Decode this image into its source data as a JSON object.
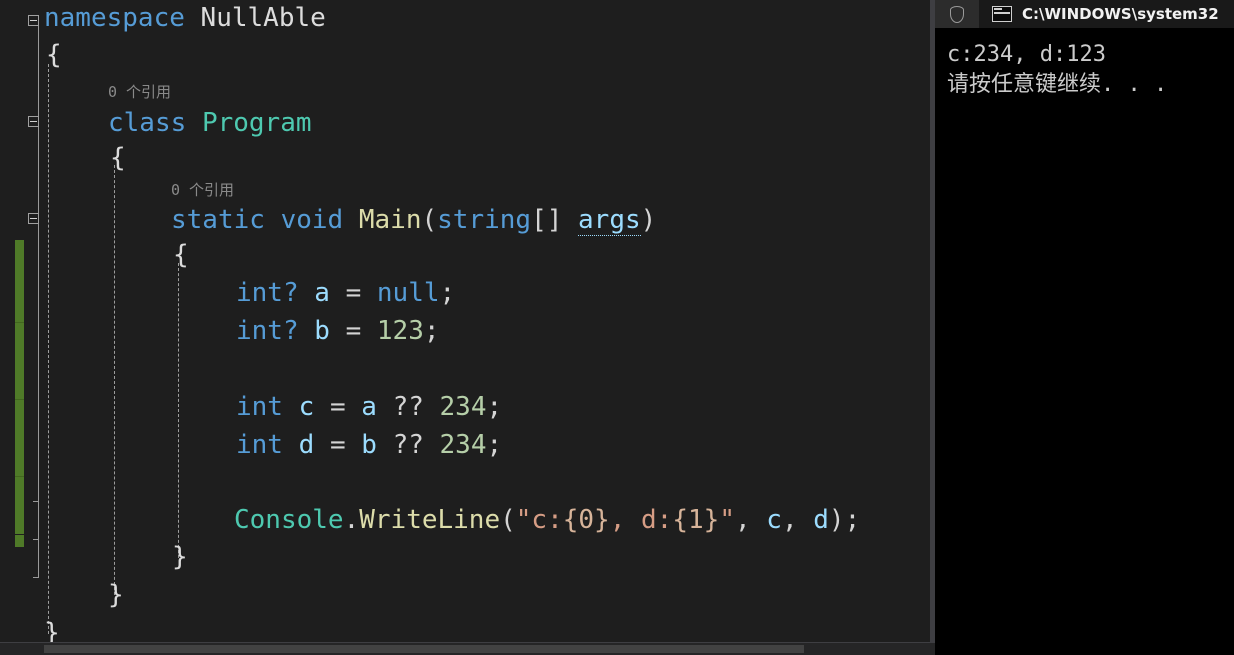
{
  "editor": {
    "language": "csharp",
    "background": "#1e1e1e",
    "change_bar_color": "#4f7a28",
    "codelens": {
      "class_refs": "0 个引用",
      "method_refs": "0 个引用"
    },
    "code_lines": [
      {
        "indent": 0,
        "text": "namespace NullAble"
      },
      {
        "indent": 0,
        "text": "{"
      },
      {
        "indent": 1,
        "text": "class Program"
      },
      {
        "indent": 1,
        "text": "{"
      },
      {
        "indent": 2,
        "text": "static void Main(string[] args)"
      },
      {
        "indent": 2,
        "text": "{"
      },
      {
        "indent": 3,
        "text": "int? a = null;"
      },
      {
        "indent": 3,
        "text": "int? b = 123;"
      },
      {
        "indent": 3,
        "text": ""
      },
      {
        "indent": 3,
        "text": "int c = a ?? 234;"
      },
      {
        "indent": 3,
        "text": "int d = b ?? 234;"
      },
      {
        "indent": 3,
        "text": ""
      },
      {
        "indent": 3,
        "text": "Console.WriteLine(\"c:{0}, d:{1}\", c, d);"
      },
      {
        "indent": 2,
        "text": "}"
      },
      {
        "indent": 1,
        "text": "}"
      },
      {
        "indent": 0,
        "text": "}"
      }
    ],
    "tokens": {
      "namespace_kw": "namespace",
      "namespace_name": "NullAble",
      "class_kw": "class",
      "class_name": "Program",
      "static_kw": "static",
      "void_kw": "void",
      "main_name": "Main",
      "string_kw": "string",
      "args_name": "args",
      "int_kw": "int",
      "nullable_mark": "?",
      "a_name": "a",
      "b_name": "b",
      "c_name": "c",
      "d_name": "d",
      "null_kw": "null",
      "num_123": "123",
      "num_234": "234",
      "coalesce_op": "??",
      "assign_op": "=",
      "console_type": "Console",
      "writeline_method": "WriteLine",
      "format_string_open": "\"c:",
      "format_arg0": "{0}",
      "format_mid": ", d:",
      "format_arg1": "{1}",
      "format_string_close": "\"",
      "semicolon": ";",
      "open_brace": "{",
      "close_brace": "}",
      "open_paren": "(",
      "close_paren": ")",
      "brackets": "[]",
      "comma": ","
    }
  },
  "console_window": {
    "title": "C:\\WINDOWS\\system32",
    "icon": "console-window-icon",
    "shield_button": "shield-icon",
    "background": "#000000",
    "titlebar_background": "#191919",
    "output_lines": [
      "c:234, d:123",
      "请按任意键继续. . ."
    ]
  }
}
